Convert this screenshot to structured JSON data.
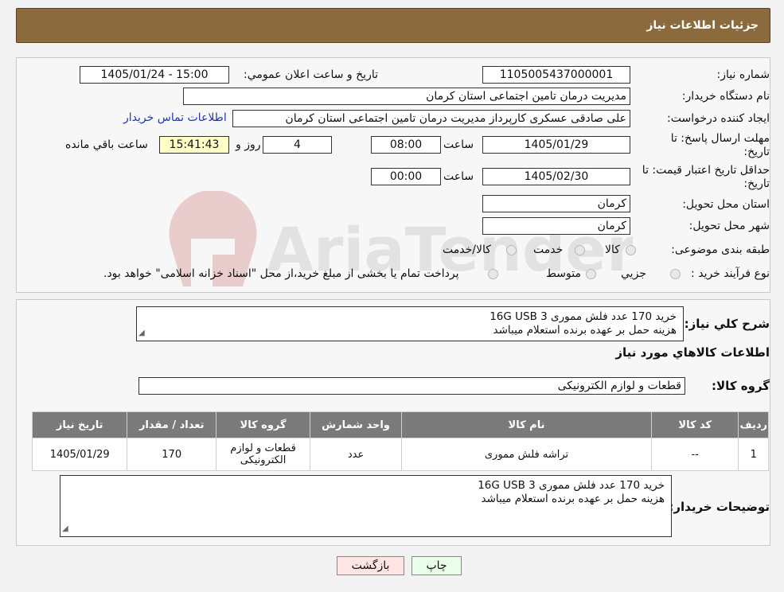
{
  "header": {
    "title": "جزئیات اطلاعات نیاز"
  },
  "form": {
    "need_number_label": "شماره نیاز:",
    "need_number": "1105005437000001",
    "announce_label": "تاريخ و ساعت اعلان عمومي:",
    "announce_value": "1405/01/24 - 15:00",
    "buyer_org_label": "نام دستگاه خريدار:",
    "buyer_org": "مدیریت درمان تامین اجتماعی استان کرمان",
    "creator_label": "ايجاد كننده درخواست:",
    "creator": "علی صادقی عسکری کارپرداز مدیریت درمان تامین اجتماعی استان کرمان",
    "contact_link": "اطلاعات تماس خريدار",
    "deadline_label_1": "مهلت ارسال پاسخ: تا",
    "deadline_label_2": "تاريخ:",
    "deadline_date": "1405/01/29",
    "time_label": "ساعت",
    "deadline_time": "08:00",
    "days_value": "4",
    "days_label": "روز و",
    "remaining_time": "15:41:43",
    "remaining_label": "ساعت باقي مانده",
    "validity_label_1": "حداقل تاريخ اعتبار قيمت: تا",
    "validity_label_2": "تاريخ:",
    "validity_date": "1405/02/30",
    "validity_time": "00:00",
    "province_label": "استان محل تحويل:",
    "province": "کرمان",
    "city_label": "شهر محل تحويل:",
    "city": "کرمان",
    "category_label": "طبقه بندی موضوعی:",
    "category_options": [
      "کالا",
      "خدمت",
      "کالا/خدمت"
    ],
    "purchase_type_label": "نوع فرآيند خريد :",
    "purchase_options": [
      "جزيي",
      "متوسط"
    ],
    "purchase_note": "پرداخت تمام يا بخشی از مبلغ خريد،از محل \"اسناد خزانه اسلامی\" خواهد بود."
  },
  "summary": {
    "label": "شرح کلي نياز:",
    "line1": "خريد 170 عدد فلش مموری 16G USB 3",
    "line2": "هزينه حمل بر عهده برنده استعلام ميباشد"
  },
  "goods": {
    "section_title": "اطلاعات کالاهاي مورد نياز",
    "group_label": "گروه کالا:",
    "group_value": "قطعات و لوازم الکترونیکی",
    "columns": [
      "رديف",
      "کد کالا",
      "نام کالا",
      "واحد شمارش",
      "گروه کالا",
      "تعداد / مقدار",
      "تاريخ نياز"
    ],
    "rows": [
      {
        "row": "1",
        "code": "--",
        "name": "تراشه فلش مموری",
        "unit": "عدد",
        "group": "قطعات و لوازم الکترونیکی",
        "qty": "170",
        "date": "1405/01/29"
      }
    ]
  },
  "buyer_notes": {
    "label": "توضيحات خريدار:",
    "line1": "خريد 170 عدد فلش مموری 16G USB 3",
    "line2": "هزينه حمل بر عهده برنده استعلام ميباشد"
  },
  "buttons": {
    "print": "چاپ",
    "back": "بازگشت"
  },
  "watermark": {
    "text": "AriaTender.neT"
  }
}
